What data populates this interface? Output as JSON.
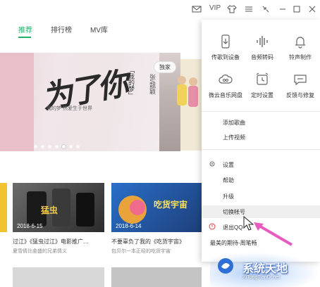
{
  "titlebar": {
    "vip": "VIP"
  },
  "tabs": [
    {
      "label": "推荐"
    },
    {
      "label": "排行榜"
    },
    {
      "label": "MV库"
    }
  ],
  "banner": {
    "calligraphy": "为了你",
    "side_title": "「我的梦」",
    "side_sub": "张/靓颖",
    "small_tag": "我的梦 热爱生于世界",
    "badge": "独家"
  },
  "cards": [
    {
      "date": "2018-6-15",
      "title": "过江》《猛虫过江》电影推广…",
      "sub": "题曲 《猛虫过江》电影推广曲",
      "sub2": "夏雪倩比金盛的兄弟情义"
    },
    {
      "date": "2018-6-14",
      "title": "不要辜负了我的《吃货宇宙》",
      "sub": "包贝尔一本正经的吃货宇宙"
    },
    {
      "title": "最美的期待-周笔畅"
    }
  ],
  "menu": {
    "grid": [
      {
        "label": "传歌到设备",
        "icon": "phone-transfer-icon"
      },
      {
        "label": "音频转码",
        "icon": "audio-wave-icon"
      },
      {
        "label": "铃声制作",
        "icon": "bell-icon"
      },
      {
        "label": "微云音乐网盘",
        "icon": "cloud-icon"
      },
      {
        "label": "定时设置",
        "icon": "alarm-clock-icon"
      },
      {
        "label": "反馈与修复",
        "icon": "chat-bubble-icon"
      }
    ],
    "list_a": [
      {
        "label": "添加歌曲"
      },
      {
        "label": "上传视频"
      }
    ],
    "list_b": [
      {
        "label": "设置",
        "icon": "gear-icon"
      },
      {
        "label": "帮助"
      },
      {
        "label": "升级"
      },
      {
        "label": "切换帐号"
      },
      {
        "label": "退出QQ",
        "icon": "power-icon"
      }
    ]
  },
  "watermark": {
    "name": "系统天地",
    "url": "XiTongTianDi.net"
  },
  "colors": {
    "accent": "#1db46a",
    "red": "#e23c3c"
  }
}
